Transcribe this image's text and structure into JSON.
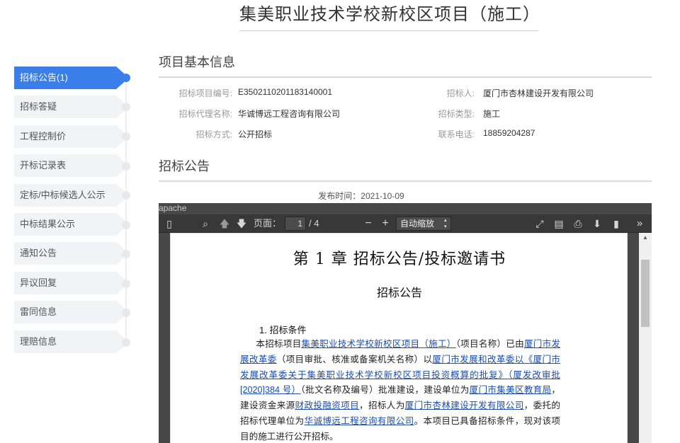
{
  "page": {
    "title": "集美职业技术学校新校区项目（施工）"
  },
  "sidebar": {
    "items": [
      {
        "label": "招标公告(1)",
        "active": true
      },
      {
        "label": "招标答疑"
      },
      {
        "label": "工程控制价"
      },
      {
        "label": "开标记录表"
      },
      {
        "label": "定标/中标候选人公示"
      },
      {
        "label": "中标结果公示"
      },
      {
        "label": "通知公告"
      },
      {
        "label": "异议回复"
      },
      {
        "label": "雷同信息"
      },
      {
        "label": "理赔信息"
      }
    ]
  },
  "basic_info": {
    "heading": "项目基本信息",
    "project_code_label": "招标项目编号:",
    "project_code": "E3502110201183140001",
    "tenderer_label": "招标人:",
    "tenderer": "厦门市杏林建设开发有限公司",
    "agency_label": "招标代理名称:",
    "agency": "华诚博远工程咨询有限公司",
    "tender_type_label": "招标类型:",
    "tender_type": "施工",
    "method_label": "招标方式:",
    "method": "公开招标",
    "phone_label": "联系电话:",
    "phone": "18859204287"
  },
  "announcement": {
    "heading": "招标公告",
    "publish_time": "发布时间：2021-10-09"
  },
  "viewer": {
    "server_text": "apache",
    "page_label": "页面：",
    "current_page": "1",
    "total_pages": "/ 4",
    "zoom_value": "自动缩放",
    "icons": [
      "sidebar-toggle-icon",
      "search-icon",
      "page-up-icon",
      "page-down-icon",
      "zoom-out-icon",
      "zoom-in-icon",
      "presentation-icon",
      "open-file-icon",
      "print-icon",
      "download-icon",
      "bookmark-icon",
      "more-tools-icon"
    ]
  },
  "document": {
    "chapter_title": "第 1 章 招标公告/投标邀请书",
    "subtitle": "招标公告",
    "section_title": "1. 招标条件",
    "p1": "本招标项目",
    "p_project": "集美职业技术学校新校区项目（施工）",
    "p2": "（项目名称）已由",
    "p_approver": "厦门市发展改革委",
    "p3": "（项目审批、核准或备案机关名称）以",
    "p_doc": "厦门市发展和改革委以《厦门市发展改革委关于集美职业技术学校新校区项目投资概算的批复》（厦发改审批[2020]384 号）",
    "p4": "（批文名称及编号）批准建设，建设单位为",
    "p_owner": "厦门市集美区教育局",
    "p5": "，建设资金来源",
    "p_fund": "财政投融资项目",
    "p6": "，招标人为",
    "p_tenderer": "厦门市杏林建设开发有限公司",
    "p7": "，委托的招标代理单位为",
    "p_agency": "华诚博远工程咨询有限公司",
    "p8": "。本项目已具备招标条件，现对该项目的施工进行公开招标。"
  },
  "colors": {
    "accent": "#3a7ee9",
    "sidebar_bg": "#f1f3f6",
    "viewer_bg": "#474747",
    "link": "#1f4ea6"
  }
}
